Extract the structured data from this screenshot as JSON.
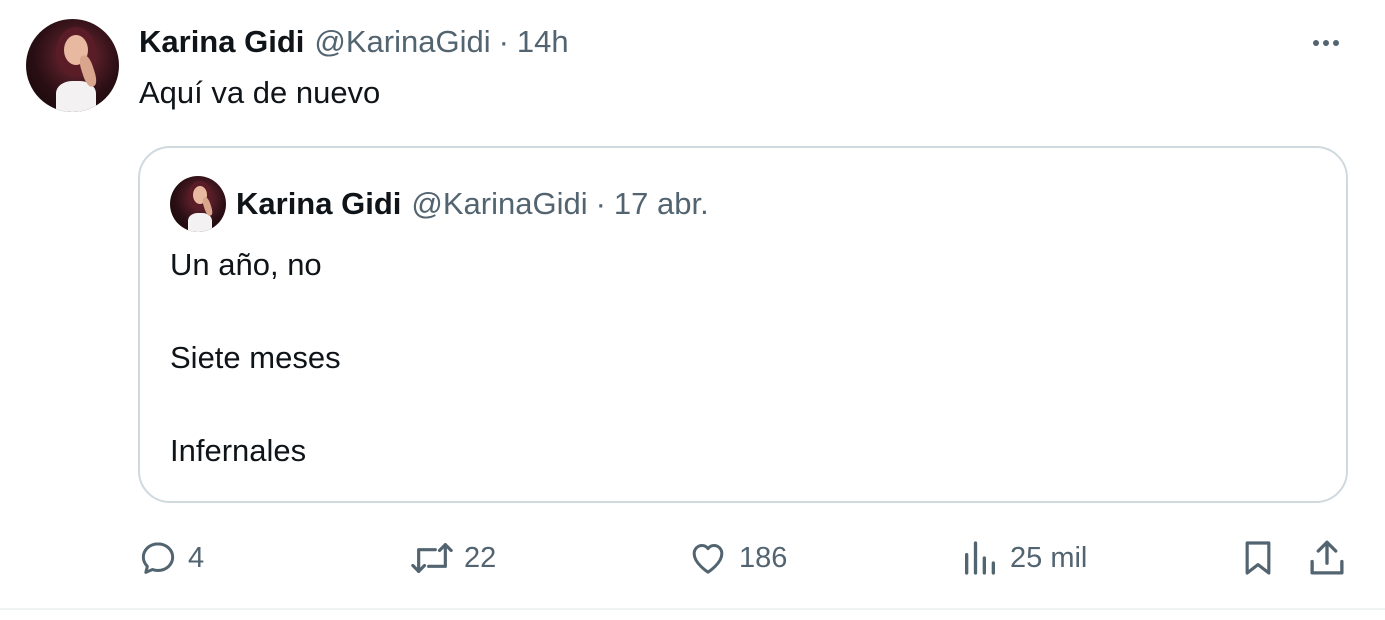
{
  "tweet": {
    "author_name": "Karina Gidi",
    "author_handle": "@KarinaGidi",
    "separator": "·",
    "time": "14h",
    "text": "Aquí va de nuevo",
    "more_icon": "more-horizontal-icon"
  },
  "quoted_tweet": {
    "author_name": "Karina Gidi",
    "author_handle": "@KarinaGidi",
    "separator": "·",
    "date": "17 abr.",
    "lines": [
      "Un año, no",
      "Siete meses",
      "Infernales"
    ]
  },
  "actions": {
    "replies": "4",
    "retweets": "22",
    "likes": "186",
    "views": "25 mil",
    "icons": [
      "reply-icon",
      "retweet-icon",
      "like-icon",
      "views-icon",
      "bookmark-icon",
      "share-icon"
    ]
  },
  "colors": {
    "primary_text": "#0f1419",
    "secondary_text": "#536471",
    "card_border": "#cfd9de",
    "divider": "#eff3f4"
  }
}
